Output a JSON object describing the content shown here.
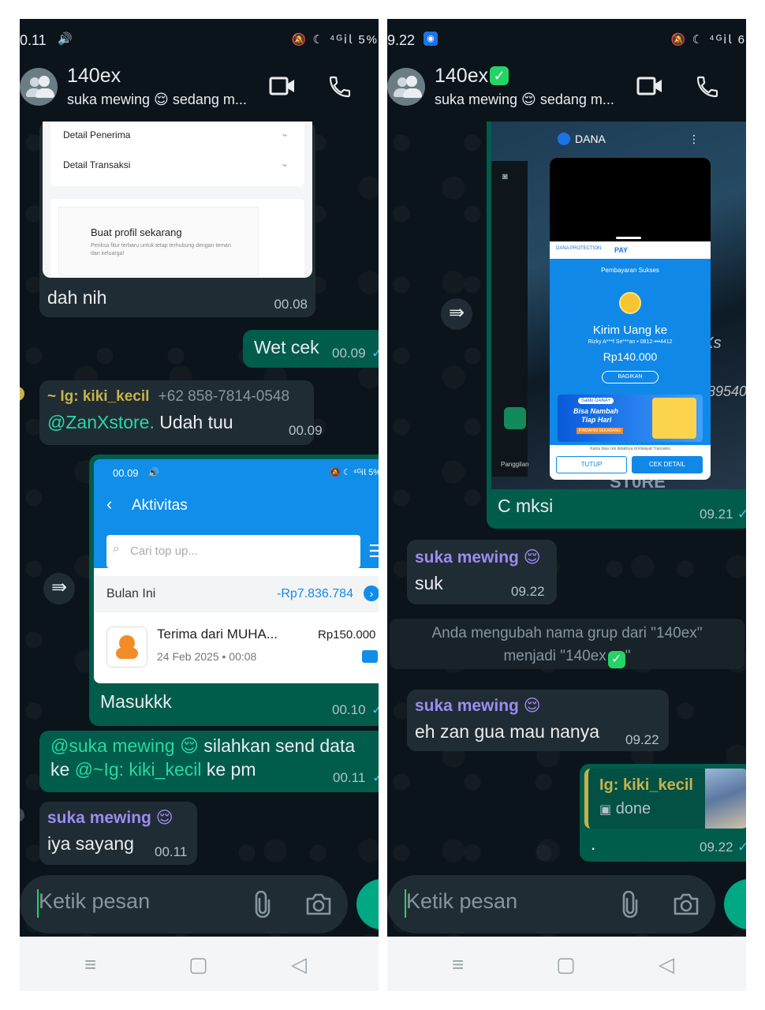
{
  "left": {
    "status": {
      "time": "0.11",
      "right": "🔕 ☾ ⁴ᴳ𝗂𝗅 5%"
    },
    "header": {
      "name": "140ex",
      "subtitle": "suka mewing 😌 sedang m..."
    },
    "image1": {
      "row1": "Detail Penerima",
      "row2": "Detail Transaksi",
      "promo_title": "Buat profil sekarang",
      "promo_sub": "Periksa fitur terbaru untuk tetap terhubung dengan teman dan keluarga!"
    },
    "msg_dah": {
      "text": "dah nih",
      "time": "00.08"
    },
    "msg_wet": {
      "text": "Wet cek",
      "time": "00.09"
    },
    "msg_kiki": {
      "sender": "~ Ig: kiki_kecil",
      "phone": "+62 858-7814-0548",
      "mention": "@ZanXstore.",
      "text": "Udah tuu",
      "time": "00.09"
    },
    "image2": {
      "status_time": "00.09",
      "status_icons": "🔕 ☾ ⁴ᴳ𝗂𝗅 5%",
      "title": "Aktivitas",
      "search_placeholder": "Cari top up...",
      "month": "Bulan Ini",
      "month_total": "-Rp7.836.784",
      "item_title": "Terima dari MUHA...",
      "item_amount": "Rp150.000",
      "item_date": "24 Feb 2025 • 00:08"
    },
    "msg_masuk": {
      "text": "Masukkk",
      "time": "00.10"
    },
    "msg_silahkan": {
      "mention1": "@suka mewing 😌",
      "text1": " silahkan send data",
      "text2a": "ke ",
      "mention2": "@~Ig: kiki_kecil",
      "text2b": " ke pm",
      "time": "00.11"
    },
    "msg_iya": {
      "sender": "suka mewing 😌",
      "text": "iya sayang",
      "time": "00.11"
    },
    "input_placeholder": "Ketik pesan"
  },
  "right": {
    "status": {
      "time": "9.22",
      "right": "🔕 ☾ ⁴ᴳ𝗂𝗅 6"
    },
    "header": {
      "name": "140ex",
      "subtitle": "suka mewing 😌 sedang m..."
    },
    "image": {
      "app_name": "DANA",
      "brand_left": "DANA PROTECTION",
      "brand_right": "PAY",
      "success": "Pembayaran Sukses",
      "title": "Kirim Uang ke",
      "recipient": "Rizky A***f Se***an • 0812-•••4412",
      "amount": "Rp140.000",
      "share": "BAGIKAN",
      "promo_badge": "Saldo DANA+",
      "promo_line1": "Bisa Nambah",
      "promo_line2": "Tiap Hari",
      "promo_cta": "PINDAHIN SEKARANG",
      "note": "Kamu bisa cek detailnya di Riwayat Transaksi",
      "btn_close": "TUTUP",
      "btn_detail": "CEK DETAIL",
      "side_label": "Panggilan",
      "bg_text1": "anXs",
      "bg_text2": "89540",
      "bg_text3": "ST0RE"
    },
    "msg_mksi": {
      "text": "C mksi",
      "time": "09.21"
    },
    "msg_suk": {
      "sender": "suka mewing 😌",
      "text": "suk",
      "time": "09.22"
    },
    "system": {
      "line1": "Anda mengubah nama grup dari \"140ex\"",
      "line2": "menjadi \"140ex",
      "line2_end": "\""
    },
    "msg_eh": {
      "sender": "suka mewing 😌",
      "text": "eh zan gua mau nanya",
      "time": "09.22"
    },
    "msg_done": {
      "quote_sender": "Ig: kiki_kecil",
      "quote_text": "done",
      "text": ".",
      "time": "09.22"
    },
    "input_placeholder": "Ketik pesan"
  },
  "colors": {
    "bg": "#0b141a",
    "incoming": "#202c33",
    "outgoing": "#005c4b",
    "accent": "#25d366",
    "tick": "#53bdeb"
  }
}
